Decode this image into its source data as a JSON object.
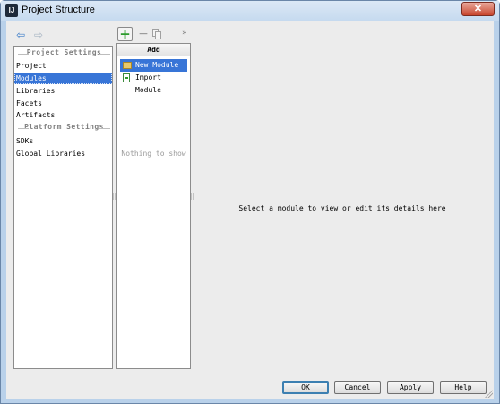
{
  "window": {
    "title": "Project Structure",
    "app_icon_text": "IJ",
    "close_glyph": "✕"
  },
  "toolbar": {
    "back_icon": "back-arrow-icon",
    "forward_icon": "forward-arrow-icon",
    "add_glyph": "+",
    "remove_glyph": "−",
    "more_glyph": "»"
  },
  "sidebar": {
    "project_settings_title": "Project Settings",
    "project_items": [
      {
        "label": "Project",
        "selected": false
      },
      {
        "label": "Modules",
        "selected": true
      },
      {
        "label": "Libraries",
        "selected": false
      },
      {
        "label": "Facets",
        "selected": false
      },
      {
        "label": "Artifacts",
        "selected": false
      }
    ],
    "platform_settings_title": "Platform Settings",
    "platform_items": [
      {
        "label": "SDKs",
        "selected": false
      },
      {
        "label": "Global Libraries",
        "selected": false
      }
    ]
  },
  "add_popup": {
    "header": "Add",
    "items": [
      {
        "label": "New Module",
        "icon": "folder-icon",
        "selected": true
      },
      {
        "label": "Import Module",
        "icon": "import-module-icon",
        "selected": false
      }
    ]
  },
  "middle_panel": {
    "empty_text": "Nothing to show"
  },
  "details": {
    "message": "Select a module to view or edit its details here"
  },
  "buttons": {
    "ok": "OK",
    "cancel": "Cancel",
    "apply": "Apply",
    "help": "Help"
  },
  "colors": {
    "selection": "#3875d7",
    "window_frame": "#b9d1ea",
    "add_green": "#2c9b2c"
  }
}
